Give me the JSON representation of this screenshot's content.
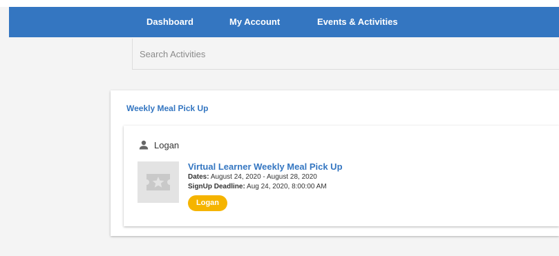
{
  "nav": {
    "items": [
      {
        "label": "Dashboard"
      },
      {
        "label": "My Account"
      },
      {
        "label": "Events & Activities"
      }
    ]
  },
  "search": {
    "placeholder": "Search Activities"
  },
  "section": {
    "title": "Weekly Meal Pick Up",
    "participant": "Logan",
    "activity": {
      "title": "Virtual Learner Weekly Meal Pick Up",
      "dates_label": "Dates:",
      "dates_value": "August 24, 2020 - August 28, 2020",
      "deadline_label": "SignUp Deadline:",
      "deadline_value": "Aug 24, 2020, 8:00:00 AM",
      "badge": "Logan"
    }
  },
  "colors": {
    "brand_blue": "#3476c1",
    "badge_yellow": "#f5b400"
  },
  "icons": {
    "participant": "person-icon",
    "thumbnail": "ticket-star-icon"
  }
}
